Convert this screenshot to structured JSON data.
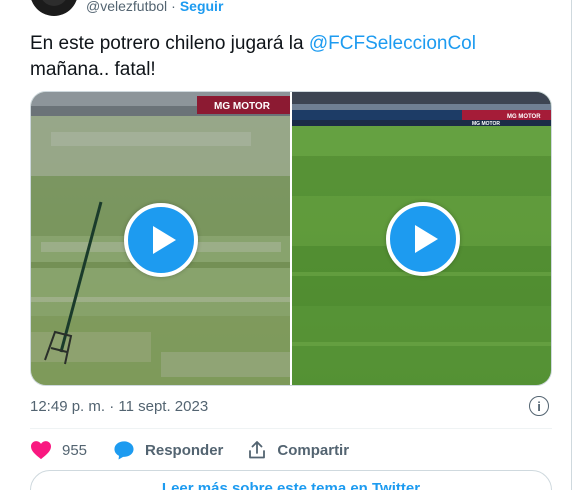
{
  "tweet": {
    "handle": "@velezfutbol",
    "separator": "·",
    "follow_label": "Seguir",
    "text_before": "En este potrero chileno jugará la ",
    "mention": "@FCFSeleccionCol",
    "text_after": " mañana.. fatal!",
    "timestamp": "12:49 p. m. · 11 sept. 2023",
    "info_icon_glyph": "i"
  },
  "media": {
    "left_banner": "MG MOTOR",
    "right_banner": "MG MOTOR",
    "right_banner_2": "MG MOTOR"
  },
  "actions": {
    "like_count": "955",
    "reply_label": "Responder",
    "share_label": "Compartir"
  },
  "read_more_label": "Leer más sobre este tema en Twitter",
  "colors": {
    "accent": "#1d9bf0",
    "like": "#f91880",
    "muted": "#536471",
    "text": "#0f1419"
  },
  "icons": [
    "heart-icon",
    "reply-bubble-icon",
    "share-icon",
    "info-icon",
    "play-icon"
  ]
}
